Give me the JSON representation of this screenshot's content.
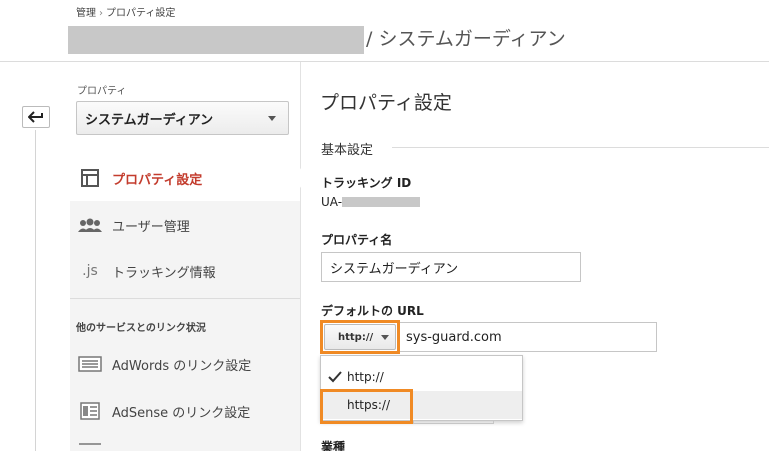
{
  "header": {
    "breadcrumb": [
      "管理",
      "プロパティ設定"
    ],
    "breadcrumb_sep": "›",
    "title": "/ システムガーディアン"
  },
  "sidebar": {
    "property_label": "プロパティ",
    "property_selected": "システムガーディアン",
    "items": [
      {
        "label": "プロパティ設定",
        "icon": "layout-icon",
        "active": true
      },
      {
        "label": "ユーザー管理",
        "icon": "users-icon"
      },
      {
        "label": "トラッキング情報",
        "icon": "js-icon",
        "icon_text": ".js"
      }
    ],
    "links_section_title": "他のサービスとのリンク状況",
    "link_items": [
      {
        "label": "AdWords のリンク設定",
        "icon": "adwords-icon"
      },
      {
        "label": "AdSense のリンク設定",
        "icon": "adsense-icon"
      }
    ]
  },
  "main": {
    "title": "プロパティ設定",
    "section_basic": "基本設定",
    "tracking_id_label": "トラッキング ID",
    "tracking_id_prefix": "UA-",
    "property_name_label": "プロパティ名",
    "property_name_value": "システムガーディアン",
    "default_url_label": "デフォルトの URL",
    "protocol_selected": "http://",
    "url_value": "sys-guard.com",
    "protocol_options": [
      "http://",
      "https://"
    ],
    "industry_label": "業種"
  },
  "colors": {
    "active_nav": "#c33c2d",
    "highlight": "#f08a24"
  }
}
